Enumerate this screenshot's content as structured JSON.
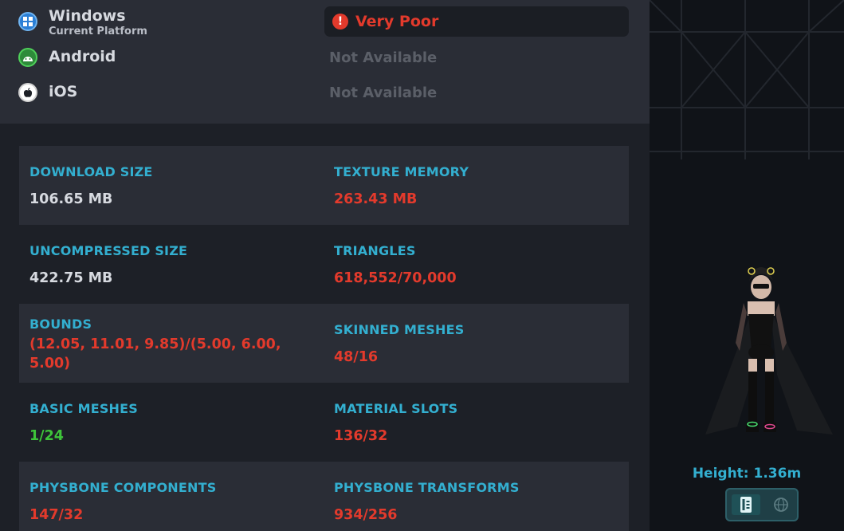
{
  "platforms": [
    {
      "name": "Windows",
      "sub": "Current Platform",
      "status": "Very Poor",
      "icon": "windows-icon"
    },
    {
      "name": "Android",
      "status": "Not Available",
      "icon": "android-icon"
    },
    {
      "name": "iOS",
      "status": "Not Available",
      "icon": "apple-icon"
    }
  ],
  "stats": [
    {
      "label": "DOWNLOAD SIZE",
      "value": "106.65 MB",
      "color": "white"
    },
    {
      "label": "TEXTURE MEMORY",
      "value": "263.43 MB",
      "color": "red"
    },
    {
      "label": "UNCOMPRESSED SIZE",
      "value": "422.75 MB",
      "color": "white"
    },
    {
      "label": "TRIANGLES",
      "value": "618,552/70,000",
      "color": "red"
    },
    {
      "label": "BOUNDS",
      "value": "(12.05, 11.01, 9.85)/(5.00, 6.00, 5.00)",
      "color": "red"
    },
    {
      "label": "SKINNED MESHES",
      "value": "48/16",
      "color": "red"
    },
    {
      "label": "BASIC MESHES",
      "value": "1/24",
      "color": "green"
    },
    {
      "label": "MATERIAL SLOTS",
      "value": "136/32",
      "color": "red"
    },
    {
      "label": "PHYSBONE COMPONENTS",
      "value": "147/32",
      "color": "red"
    },
    {
      "label": "PHYSBONE TRANSFORMS",
      "value": "934/256",
      "color": "red"
    }
  ],
  "preview": {
    "height_label": "Height: 1.36m",
    "buttons": [
      "book-icon",
      "globe-icon"
    ]
  },
  "colors": {
    "accent": "#33afd0",
    "bad": "#e33a2c",
    "good": "#3ec43a",
    "panel": "#2a2d36"
  }
}
